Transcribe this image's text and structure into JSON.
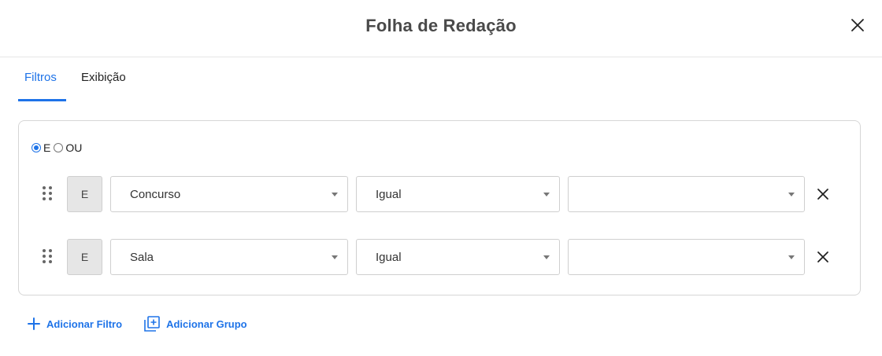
{
  "dialog": {
    "title": "Folha de Redação",
    "close_icon": "close-icon"
  },
  "tabs": [
    {
      "label": "Filtros",
      "active": true
    },
    {
      "label": "Exibição",
      "active": false
    }
  ],
  "logic": {
    "options": [
      "E",
      "OU"
    ],
    "selected": "E"
  },
  "filters": [
    {
      "conjunction": "E",
      "field": "Concurso",
      "operator": "Igual",
      "value": ""
    },
    {
      "conjunction": "E",
      "field": "Sala",
      "operator": "Igual",
      "value": ""
    }
  ],
  "actions": {
    "add_filter": "Adicionar Filtro",
    "add_group": "Adicionar Grupo"
  },
  "colors": {
    "accent": "#1e73e8",
    "border": "#d6d6d6"
  }
}
